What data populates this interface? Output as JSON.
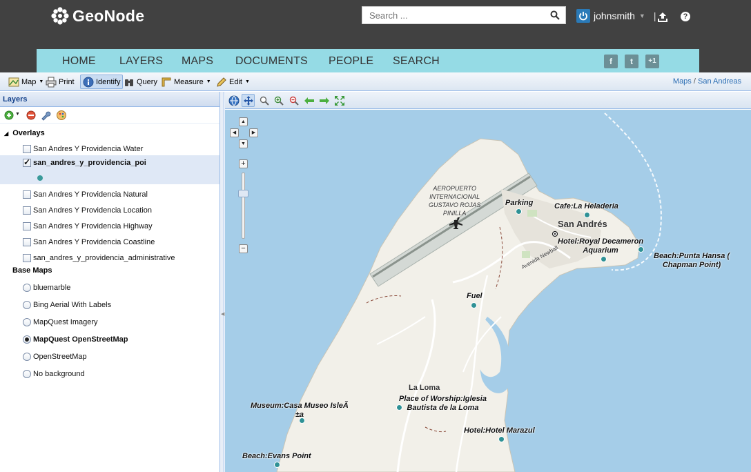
{
  "header": {
    "brand": "GeoNode",
    "search_placeholder": "Search ...",
    "username": "johnsmith",
    "separator": "|",
    "help_glyph": "?"
  },
  "nav": {
    "items": [
      "HOME",
      "LAYERS",
      "MAPS",
      "DOCUMENTS",
      "PEOPLE",
      "SEARCH"
    ],
    "social": [
      "f",
      "t",
      "+1"
    ]
  },
  "toolbar": {
    "map": "Map",
    "print": "Print",
    "identify": "Identify",
    "query": "Query",
    "measure": "Measure",
    "edit": "Edit",
    "breadcrumb_parent": "Maps",
    "breadcrumb_sep": "/",
    "breadcrumb_current": "San Andreas"
  },
  "layers_panel": {
    "title": "Layers",
    "overlays_label": "Overlays",
    "overlays": [
      {
        "label": "San Andres Y Providencia Water",
        "checked": false
      },
      {
        "label": "san_andres_y_providencia_poi",
        "checked": true
      },
      {
        "label": "San Andres Y Providencia Natural",
        "checked": false
      },
      {
        "label": "San Andres Y Providencia Location",
        "checked": false
      },
      {
        "label": "San Andres Y Providencia Highway",
        "checked": false
      },
      {
        "label": "San Andres Y Providencia Coastline",
        "checked": false
      },
      {
        "label": "san_andres_y_providencia_administrative",
        "checked": false
      }
    ],
    "basemaps_label": "Base Maps",
    "basemaps": [
      {
        "label": "bluemarble",
        "selected": false
      },
      {
        "label": "Bing Aerial With Labels",
        "selected": false
      },
      {
        "label": "MapQuest Imagery",
        "selected": false
      },
      {
        "label": "MapQuest OpenStreetMap",
        "selected": true
      },
      {
        "label": "OpenStreetMap",
        "selected": false
      },
      {
        "label": "No background",
        "selected": false
      }
    ]
  },
  "map": {
    "colors": {
      "water": "#a5cde8",
      "land": "#f2f0e9",
      "poi": "#2f9195"
    },
    "place_labels": {
      "airport": [
        "AEROPUERTO",
        "INTERNACIONAL",
        "GUSTAVO ROJAS",
        "PINILLA"
      ],
      "town": "San Andrés",
      "la_loma": "La Loma",
      "avenue": "Avenida Newball"
    },
    "pois": [
      "Parking",
      "Cafe:La Heladeria",
      "Hotel:Royal Decameron",
      "Aquarium",
      "Beach:Punta Hansa (",
      "Chapman Point)",
      "Fuel",
      "Museum:Casa Museo IsleÃ",
      "±a",
      "Place of Worship:Iglesia",
      "Bautista de la Loma",
      "Hotel:Hotel Marazul",
      "Beach:Evans Point"
    ]
  }
}
